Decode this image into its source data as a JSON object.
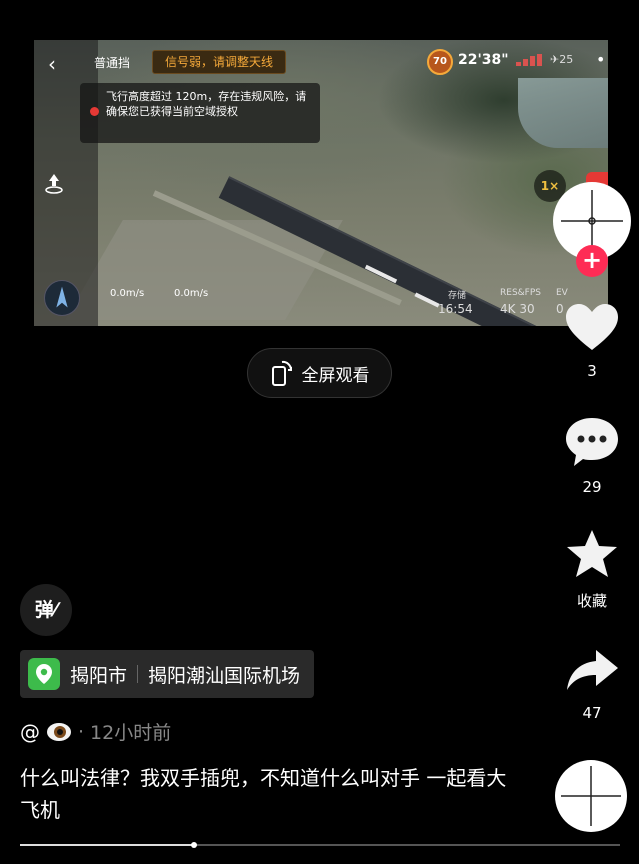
{
  "video": {
    "mode_label": "普通挡",
    "signal_warning": "信号弱，请调整天线",
    "battery_level": "70",
    "flight_time": "22'38\"",
    "satellites": "25",
    "altitude_alert": "飞行高度超过 120m，存在违规风险，请确保您已获得当前空域授权",
    "horizontal_speed": "0.0m/s",
    "vertical_speed": "0.0m/s",
    "zoom_label": "1×",
    "storage_label": "存储",
    "storage_value": "16:54",
    "res_label": "RES&FPS",
    "res_value": "4K 30",
    "ev_label": "EV",
    "ev_value": "0"
  },
  "fullscreen_label": "全屏观看",
  "actions": {
    "like_count": "3",
    "comment_count": "29",
    "favorite_label": "收藏",
    "share_count": "47"
  },
  "danmaku_label": "弹",
  "location": {
    "city": "揭阳市",
    "place": "揭阳潮汕国际机场"
  },
  "author": {
    "prefix": "@",
    "time_ago": "12小时前",
    "separator": "·"
  },
  "caption": "什么叫法律？我双手插兜，不知道什么叫对手 一起看大飞机",
  "progress": {
    "fraction": 0.29
  },
  "colors": {
    "accent": "#fe2c55",
    "location_green": "#3dbb4b",
    "warning_orange": "#f5a93a"
  }
}
